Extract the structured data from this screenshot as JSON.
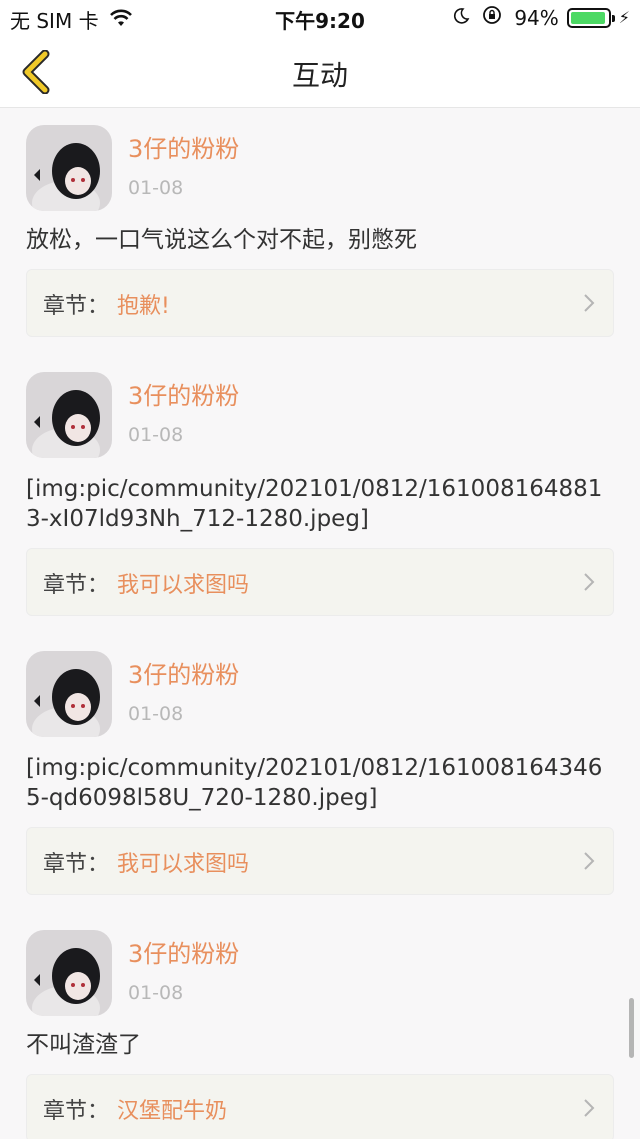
{
  "status_bar": {
    "carrier": "无 SIM 卡",
    "time": "下午9:20",
    "battery_percent": "94%",
    "battery_level": 0.94
  },
  "nav": {
    "title": "互动",
    "back_icon": "chevron-left-icon",
    "accent": "#e8c020"
  },
  "chapter_prefix": "章节：",
  "items": [
    {
      "username": "3仔的粉粉",
      "date": "01-08",
      "text": "放松，一口气说这么个对不起，别憋死",
      "chapter": "抱歉!"
    },
    {
      "username": "3仔的粉粉",
      "date": "01-08",
      "text": "[img:pic/community/202101/0812/1610081648813-xI07ld93Nh_712-1280.jpeg]",
      "chapter": "我可以求图吗"
    },
    {
      "username": "3仔的粉粉",
      "date": "01-08",
      "text": "[img:pic/community/202101/0812/1610081643465-qd6098l58U_720-1280.jpeg]",
      "chapter": "我可以求图吗"
    },
    {
      "username": "3仔的粉粉",
      "date": "01-08",
      "text": "不叫渣渣了",
      "chapter": "汉堡配牛奶"
    }
  ],
  "colors": {
    "accent_orange": "#e88f5d",
    "chapter_bg": "#f4f4ef",
    "date_gray": "#b8b8b8"
  }
}
